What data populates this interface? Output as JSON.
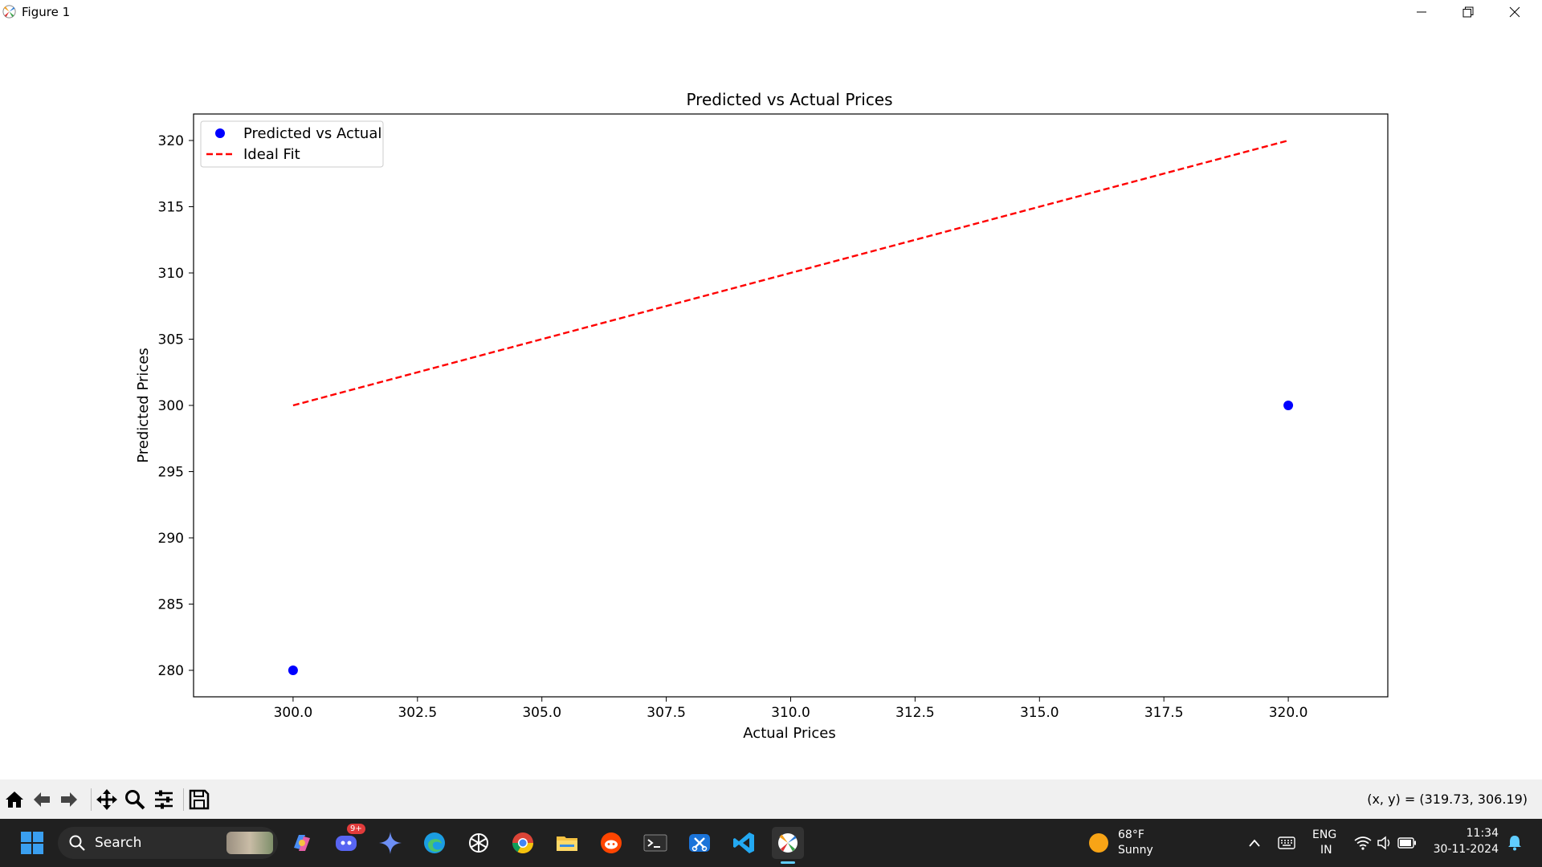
{
  "window": {
    "title": "Figure 1"
  },
  "chart_data": {
    "type": "scatter",
    "title": "Predicted vs Actual Prices",
    "xlabel": "Actual Prices",
    "ylabel": "Predicted Prices",
    "xlim": [
      298.0,
      322.0
    ],
    "ylim": [
      278.0,
      322.0
    ],
    "xticks": [
      "300.0",
      "302.5",
      "305.0",
      "307.5",
      "310.0",
      "312.5",
      "315.0",
      "317.5",
      "320.0"
    ],
    "xtick_values": [
      300.0,
      302.5,
      305.0,
      307.5,
      310.0,
      312.5,
      315.0,
      317.5,
      320.0
    ],
    "yticks": [
      "280",
      "285",
      "290",
      "295",
      "300",
      "305",
      "310",
      "315",
      "320"
    ],
    "ytick_values": [
      280,
      285,
      290,
      295,
      300,
      305,
      310,
      315,
      320
    ],
    "series": [
      {
        "name": "Predicted vs Actual",
        "kind": "scatter",
        "color": "#0000ff",
        "x": [
          300.0,
          320.0
        ],
        "y": [
          280.0,
          300.0
        ]
      },
      {
        "name": "Ideal Fit",
        "kind": "line",
        "style": "dashed",
        "color": "#ff0000",
        "x": [
          300.0,
          320.0
        ],
        "y": [
          300.0,
          320.0
        ]
      }
    ],
    "legend": "top-left",
    "grid": false
  },
  "toolbar": {
    "buttons": [
      "home-icon",
      "back-icon",
      "forward-icon",
      "pan-icon",
      "zoom-icon",
      "configure-icon",
      "save-icon"
    ],
    "coords": "(x, y) = (319.73, 306.19)"
  },
  "taskbar": {
    "search_label": "Search",
    "discord_badge": "9+",
    "weather": {
      "temp": "68°F",
      "condition": "Sunny"
    },
    "lang": {
      "line1": "ENG",
      "line2": "IN"
    },
    "time": "11:34",
    "date": "30-11-2024"
  }
}
